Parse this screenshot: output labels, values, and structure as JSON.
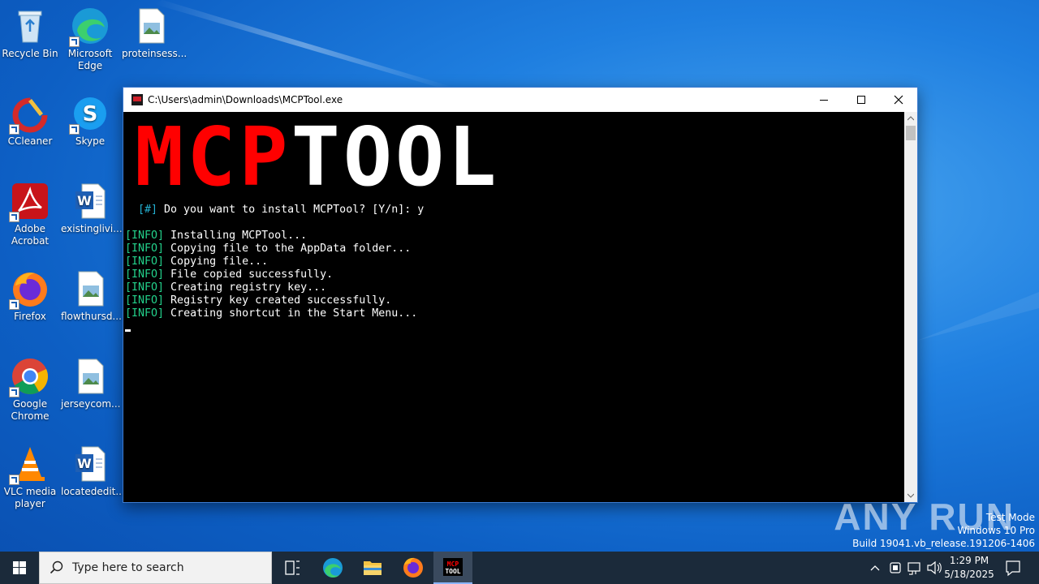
{
  "desktop": {
    "icons": [
      {
        "label": "Recycle Bin"
      },
      {
        "label": "Microsoft Edge"
      },
      {
        "label": "proteinsess..."
      },
      {
        "label": "CCleaner"
      },
      {
        "label": "Skype"
      },
      {
        "label": "Adobe Acrobat"
      },
      {
        "label": "existinglivi..."
      },
      {
        "label": "Firefox"
      },
      {
        "label": "flowthursd..."
      },
      {
        "label": "Google Chrome"
      },
      {
        "label": "jerseycom..."
      },
      {
        "label": "VLC media player"
      },
      {
        "label": "locatededit..."
      }
    ]
  },
  "window": {
    "title": "C:\\Users\\admin\\Downloads\\MCPTool.exe",
    "logo_red": "MCP",
    "logo_white": "TOOL",
    "prompt_tag": "[#]",
    "prompt_text": " Do you want to install MCPTool? [Y/n]: y",
    "info_tag": "[INFO]",
    "lines": [
      " Installing MCPTool...",
      " Copying file to the AppData folder...",
      " Copying file...",
      " File copied successfully.",
      " Creating registry key...",
      " Registry key created successfully.",
      " Creating shortcut in the Start Menu..."
    ]
  },
  "watermark": {
    "brand": "ANY RUN",
    "test_mode": "Test Mode",
    "os": "Windows 10 Pro",
    "build": "Build 19041.vb_release.191206-1406"
  },
  "taskbar": {
    "search_placeholder": "Type here to search",
    "time": "1:29 PM",
    "date": "5/18/2025",
    "active_app_label": "MCP TOOL"
  },
  "colors": {
    "info_tag": "#23d18b",
    "prompt_tag": "#23b0d1",
    "logo_red": "#ff0000"
  }
}
